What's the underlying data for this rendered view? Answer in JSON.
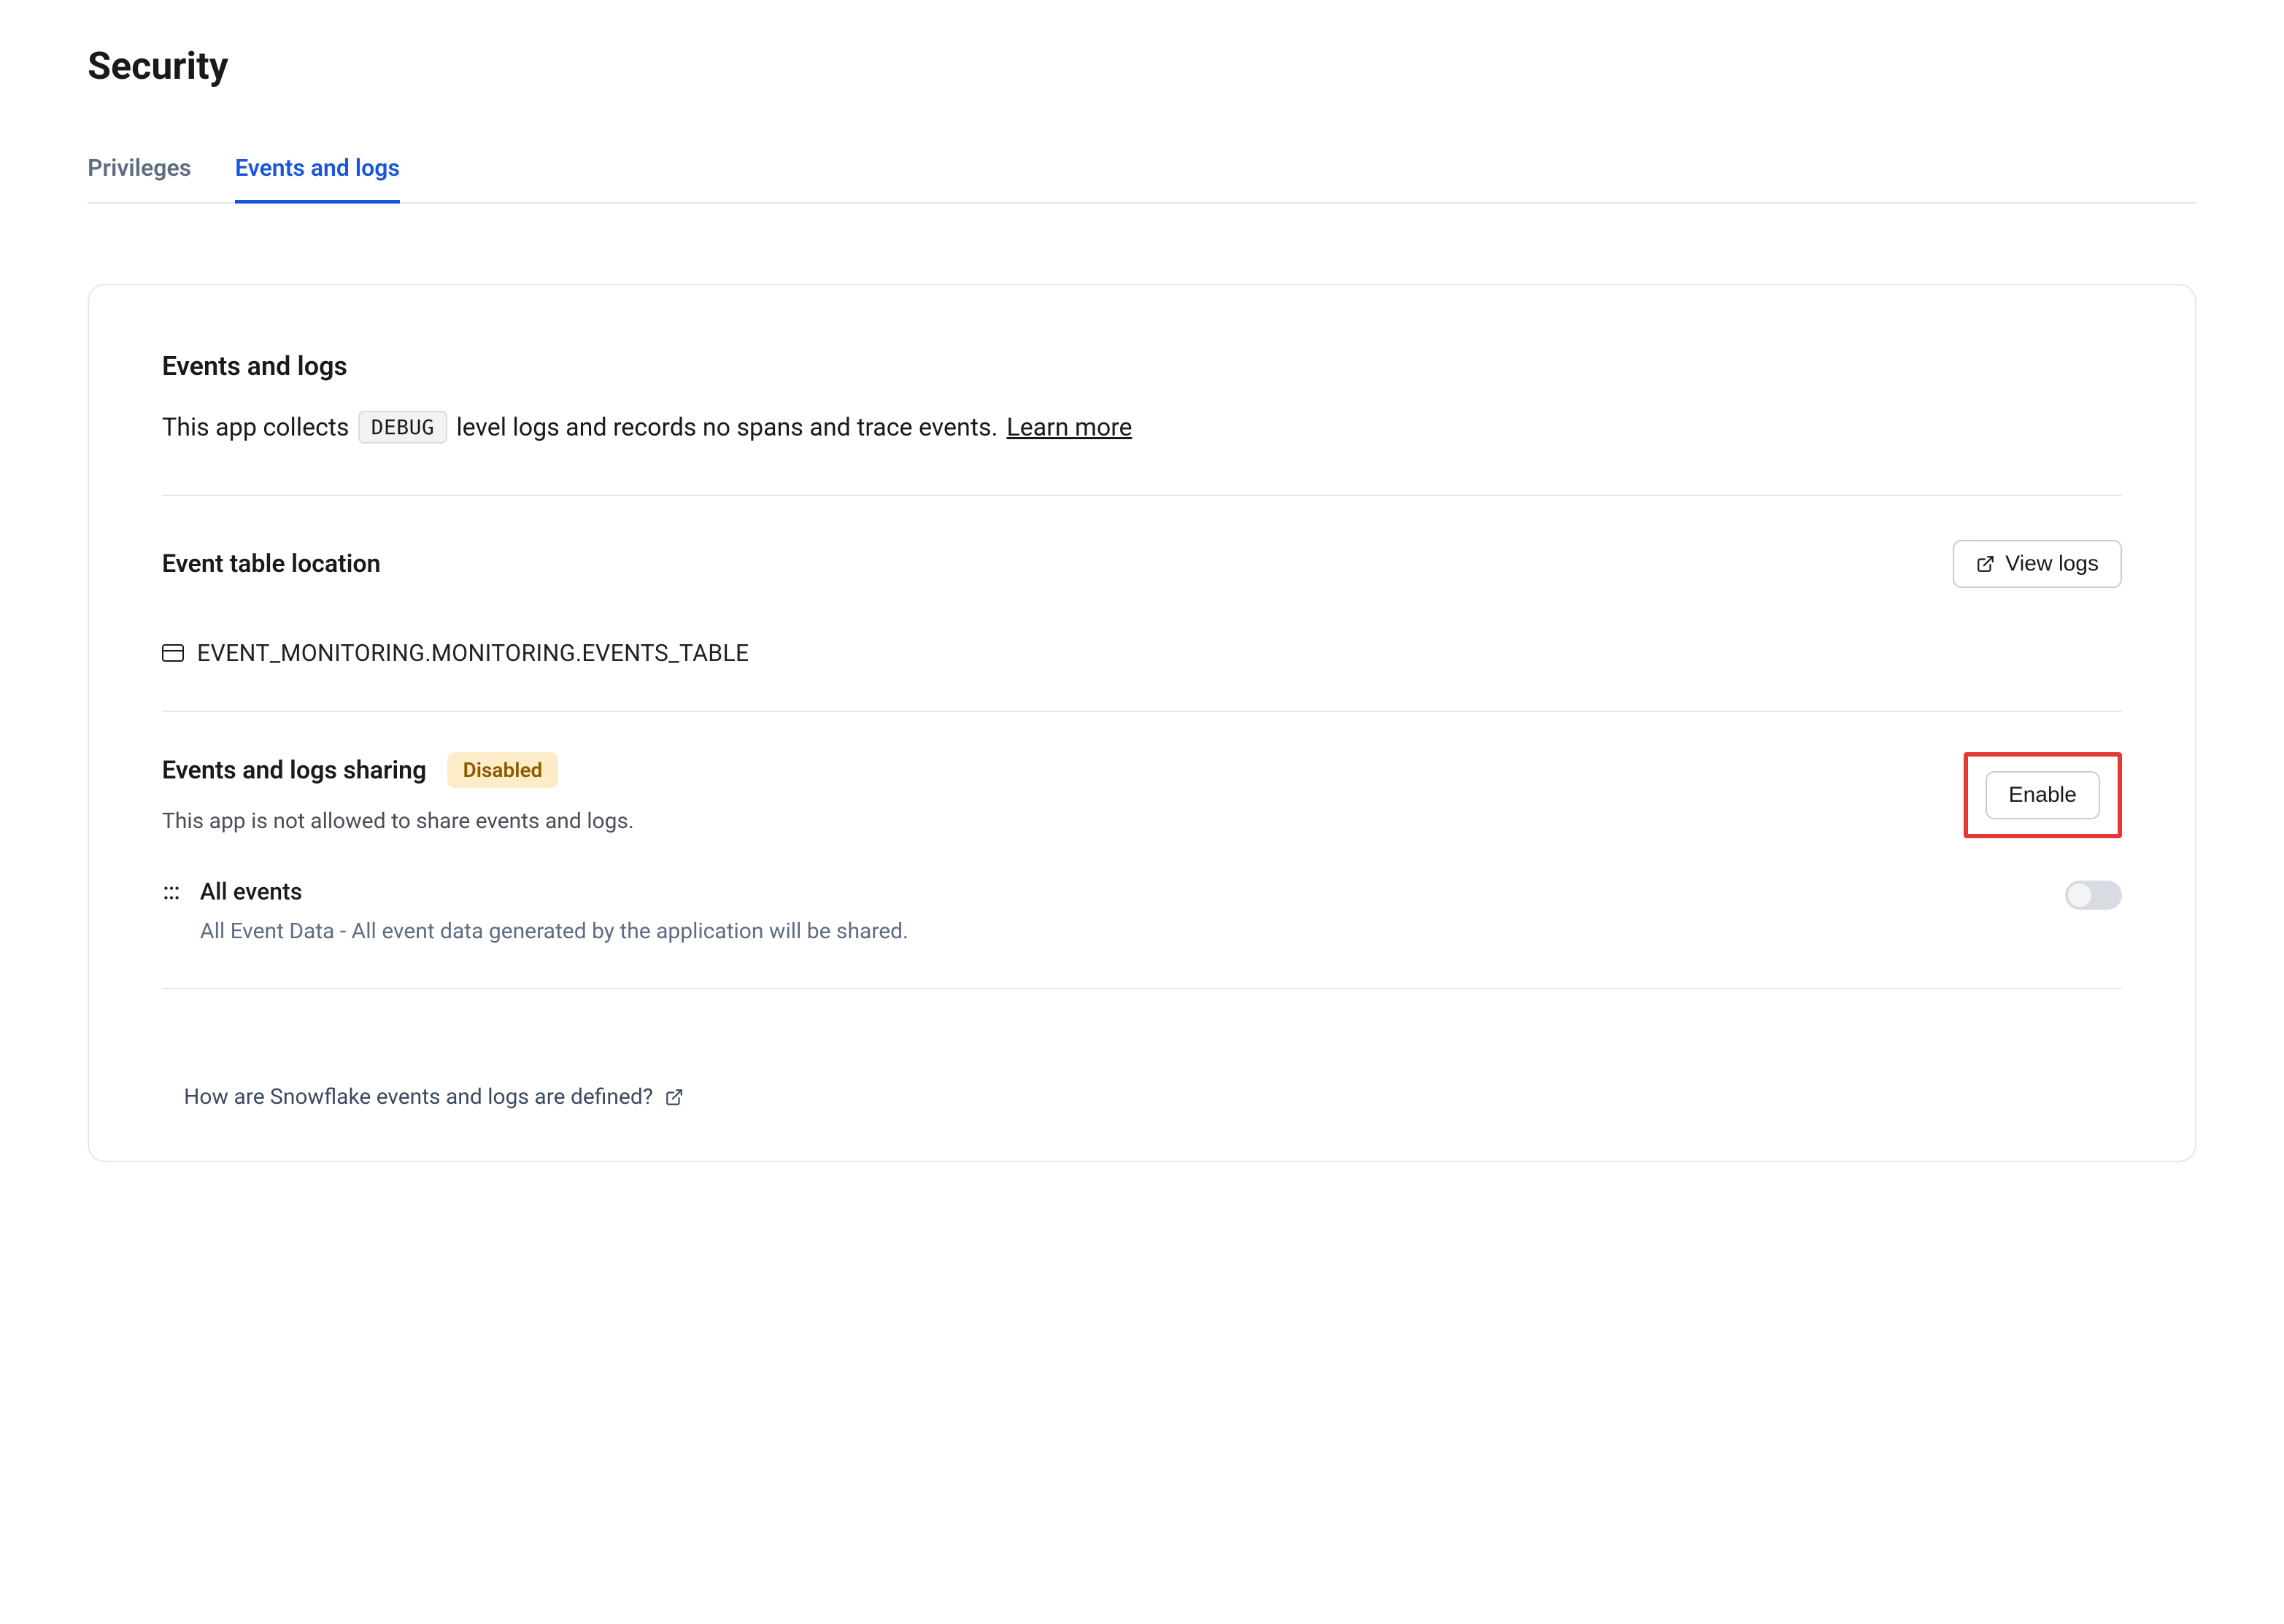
{
  "page": {
    "title": "Security"
  },
  "tabs": [
    {
      "label": "Privileges",
      "active": false
    },
    {
      "label": "Events and logs",
      "active": true
    }
  ],
  "events_section": {
    "title": "Events and logs",
    "description_prefix": "This app collects",
    "log_level_chip": "DEBUG",
    "description_suffix": "level logs and records no spans and trace events.",
    "learn_more": "Learn more"
  },
  "location_section": {
    "title": "Event table location",
    "view_logs_button": "View logs",
    "location": "EVENT_MONITORING.MONITORING.EVENTS_TABLE"
  },
  "sharing_section": {
    "title": "Events and logs sharing",
    "status_badge": "Disabled",
    "enable_button": "Enable",
    "description": "This app is not allowed to share events and logs.",
    "item": {
      "title": "All events",
      "subtitle": "All Event Data - All event data generated by the application will be shared."
    }
  },
  "footer": {
    "help_link": "How are Snowflake events and logs are defined?"
  }
}
